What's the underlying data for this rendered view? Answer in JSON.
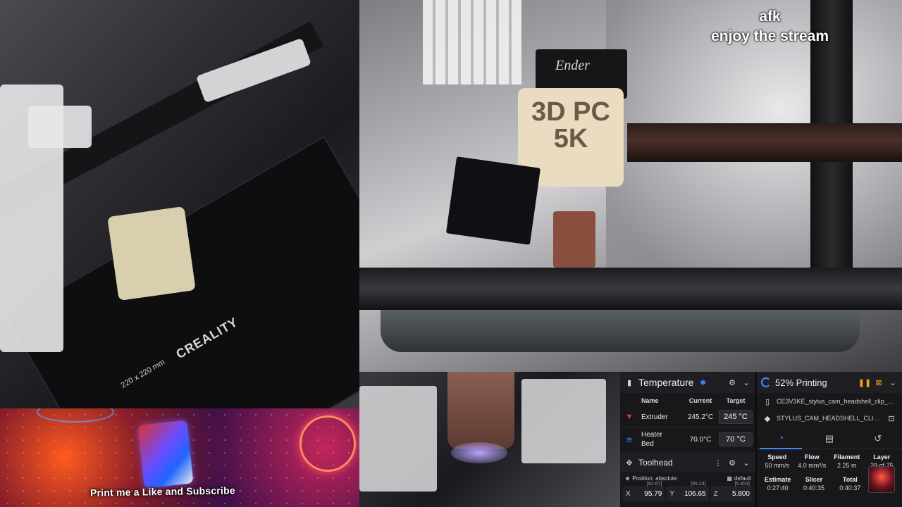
{
  "overlay": {
    "line1": "afk",
    "line2": "enjoy the stream"
  },
  "camera_left": {
    "brand": "CREALITY",
    "bed_size": "220 x 220 mm"
  },
  "camera_right": {
    "motor_label": "Ender",
    "fan_text": "3D PC 5K"
  },
  "banner": {
    "cta": "Print me a Like and Subscribe"
  },
  "temperature": {
    "title": "Temperature",
    "columns": {
      "name": "Name",
      "current": "Current",
      "target": "Target"
    },
    "rows": [
      {
        "name": "Extruder",
        "current": "245.2°C",
        "target": "245 °C",
        "icon": "nozzle-icon",
        "color": "#e53935"
      },
      {
        "name": "Heater Bed",
        "current": "70.0°C",
        "target": "70 °C",
        "icon": "heat-bed-icon",
        "color": "#3d8bff"
      }
    ]
  },
  "toolhead": {
    "title": "Toolhead",
    "position_mode": "Position: absolute",
    "profile": "default",
    "coords": [
      {
        "axis": "X",
        "value": "95.79",
        "commanded": "[82.67]"
      },
      {
        "axis": "Y",
        "value": "106.65",
        "commanded": "[95.24]"
      },
      {
        "axis": "Z",
        "value": "5.800",
        "commanded": "[5.853]"
      }
    ]
  },
  "print_status": {
    "progress_percent": 52,
    "status": "52% Printing",
    "file": "CE3V3KE_stylus_cam_headshell_clip_...",
    "object": "STYLUS_CAM_HEADSHELL_CLIP_...",
    "stats": [
      {
        "label": "Speed",
        "value": "50 mm/s"
      },
      {
        "label": "Flow",
        "value": "4.0 mm³/s"
      },
      {
        "label": "Filament",
        "value": "2.25 m"
      },
      {
        "label": "Layer",
        "value": "29 of 75"
      }
    ],
    "times": [
      {
        "label": "Estimate",
        "value": "0:27:40"
      },
      {
        "label": "Slicer",
        "value": "0:40:35"
      },
      {
        "label": "Total",
        "value": "0:40:37"
      }
    ],
    "accent": "#3d8bff",
    "pause_color": "#ff9d1a"
  }
}
